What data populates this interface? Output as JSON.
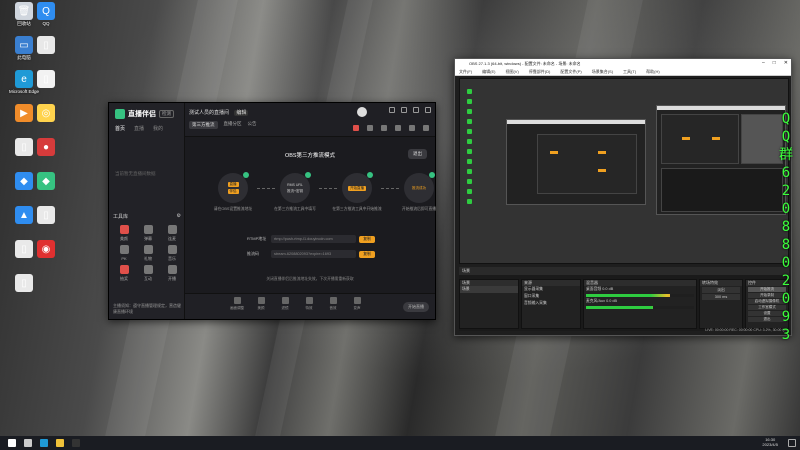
{
  "desktop": {
    "icons": [
      {
        "label": "回收站",
        "color": "#d0d6de",
        "glyph": "🗑"
      },
      {
        "label": "QQ",
        "color": "#2f8df0",
        "glyph": "Q"
      },
      {
        "label": "此电脑",
        "color": "#3a7fd0",
        "glyph": "▭"
      },
      {
        "label": "",
        "color": "#e8e8e8",
        "glyph": "▯"
      },
      {
        "label": "Microsoft Edge",
        "color": "#1f9ad6",
        "glyph": "e"
      },
      {
        "label": "",
        "color": "#f2f2f2",
        "glyph": "▯"
      },
      {
        "label": "",
        "color": "#f08c2a",
        "glyph": "▶"
      },
      {
        "label": "",
        "color": "#ffd34d",
        "glyph": "◎"
      },
      {
        "label": "",
        "color": "#e9e9e9",
        "glyph": "▯"
      },
      {
        "label": "",
        "color": "#d63b3b",
        "glyph": "●"
      },
      {
        "label": "",
        "color": "#2f8df0",
        "glyph": "◆"
      },
      {
        "label": "",
        "color": "#36c281",
        "glyph": "◆"
      },
      {
        "label": "",
        "color": "#2f8df0",
        "glyph": "▲"
      },
      {
        "label": "",
        "color": "#e9e9e9",
        "glyph": "▯"
      },
      {
        "label": "",
        "color": "#e9e9e9",
        "glyph": "▯"
      },
      {
        "label": "",
        "color": "#e03030",
        "glyph": "◉"
      },
      {
        "label": "",
        "color": "#e9e9e9",
        "glyph": "▯"
      }
    ]
  },
  "companion": {
    "app_name": "直播伴侣",
    "version_badge": "检测",
    "tabs": [
      "首页",
      "直播",
      "我的"
    ],
    "empty_text": "当前暂无直播间数据",
    "tools_title": "工具库",
    "tools": [
      "美颜",
      "弹幕",
      "连麦",
      "PK",
      "礼物",
      "音乐",
      "抽奖",
      "互动",
      "开播"
    ],
    "footer": "主播须知：遵守直播管理规定，营造健康直播环境",
    "room_title": "测试人员的直播间",
    "room_tag": "编辑",
    "meta": [
      "第三方推流",
      "直播分区",
      "公告"
    ],
    "main_title": "OBS第三方推流模式",
    "back_button": "退出",
    "steps": [
      {
        "top": "直播",
        "bottom": "伴侣",
        "caption": "请在OBS设置推流地址"
      },
      {
        "top": "RMS URL",
        "bottom": "推流+密钥",
        "caption": "在第三方推流工具中填写"
      },
      {
        "top": "开始直播",
        "bottom": "",
        "caption": "在第三方推流工具中开始推流"
      },
      {
        "top": "推流成功",
        "bottom": "",
        "caption": "开始推流后即可直播"
      }
    ],
    "fields": [
      {
        "label": "RTMP地址",
        "value": "rtmp://push-rtmp-l1.douyincdn.com",
        "copy": "复制"
      },
      {
        "label": "推流码",
        "value": "stream-6208802093?expire=1693",
        "copy": "复制"
      }
    ],
    "note": "关闭直播伴侣后推流地址失效，下次开播需重新获取",
    "bottom_tools": [
      "画面调整",
      "美颜",
      "滤镜",
      "特效",
      "音效",
      "变声"
    ],
    "live_button": "开始直播"
  },
  "obs": {
    "title": "OBS 27.1.3 (64-bit, windows) - 配置文件: 未命名 - 场景: 未命名",
    "menus": [
      "文件(F)",
      "编辑(E)",
      "视图(V)",
      "停靠部件(D)",
      "配置文件(P)",
      "场景集合(S)",
      "工具(T)",
      "帮助(H)"
    ],
    "dock_tabs": [
      "场景",
      "来源",
      "混音器",
      "转场特效",
      "控件"
    ],
    "scene": "场景",
    "sources": [
      "显示器采集",
      "窗口采集",
      "音频输入采集"
    ],
    "mixer": [
      {
        "name": "桌面音频",
        "db": "0.0 dB",
        "level": 0.78
      },
      {
        "name": "麦克风/Aux",
        "db": "0.0 dB",
        "level": 0.62
      }
    ],
    "transition": "淡出",
    "duration": "300 ms",
    "controls": [
      "开始推流",
      "开始录制",
      "启动虚拟摄像机",
      "工作室模式",
      "设置",
      "退出"
    ],
    "status": "LIVE: 00:00:00  REC: 00:00:00  CPU: 3.2%, 30.00 fps"
  },
  "overlay_chars": [
    "Q",
    "Q",
    "群",
    "6",
    "2",
    "0",
    "8",
    "8",
    "0",
    "2",
    "0",
    "9",
    "3"
  ],
  "taskbar": {
    "time": "16:30",
    "date": "2023/4/5",
    "apps": [
      {
        "name": "start",
        "color": "#ffffff"
      },
      {
        "name": "search",
        "color": "#cccccc"
      },
      {
        "name": "edge",
        "color": "#1f9ad6"
      },
      {
        "name": "files",
        "color": "#f0c23a"
      },
      {
        "name": "obs",
        "color": "#333333"
      }
    ]
  }
}
